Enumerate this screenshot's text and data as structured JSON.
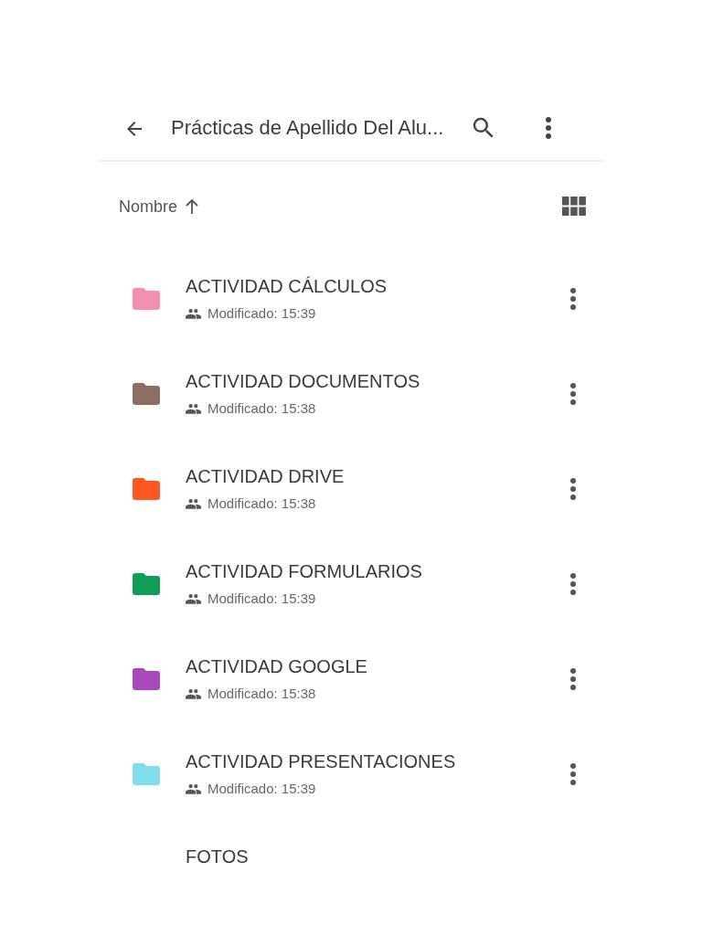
{
  "toolbar": {
    "title": "Prácticas de Apellido Del Alu..."
  },
  "sort": {
    "label": "Nombre"
  },
  "folders": [
    {
      "name": "ACTIVIDAD CÁLCULOS",
      "modified": "Modificado: 15:39",
      "shared": true,
      "color": "#f48fb1"
    },
    {
      "name": "ACTIVIDAD DOCUMENTOS",
      "modified": "Modificado: 15:38",
      "shared": true,
      "color": "#8d6e63"
    },
    {
      "name": "ACTIVIDAD DRIVE",
      "modified": "Modificado: 15:38",
      "shared": true,
      "color": "#ff5722"
    },
    {
      "name": "ACTIVIDAD FORMULARIOS",
      "modified": "Modificado: 15:39",
      "shared": true,
      "color": "#0f9d58"
    },
    {
      "name": "ACTIVIDAD GOOGLE",
      "modified": "Modificado: 15:38",
      "shared": true,
      "color": "#ab47bc"
    },
    {
      "name": "ACTIVIDAD PRESENTACIONES",
      "modified": "Modificado: 15:39",
      "shared": true,
      "color": "#80deea"
    },
    {
      "name": "FOTOS"
    }
  ]
}
